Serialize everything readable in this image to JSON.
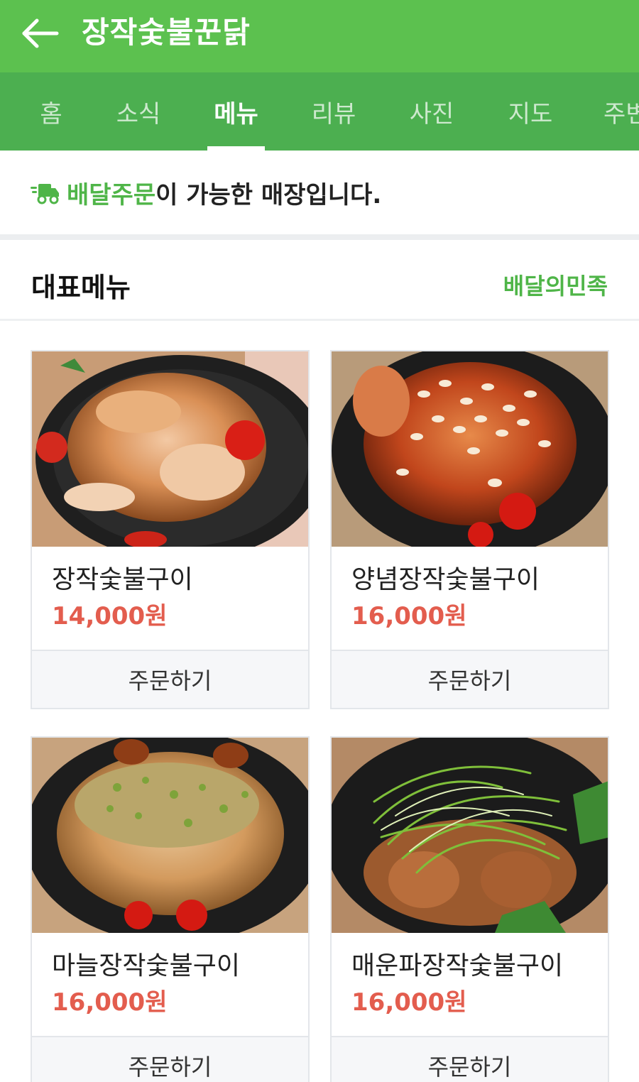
{
  "header": {
    "title": "장작숯불꾼닭",
    "back_icon": "back-arrow-icon"
  },
  "tabs": [
    {
      "label": "홈",
      "active": false
    },
    {
      "label": "소식",
      "active": false
    },
    {
      "label": "메뉴",
      "active": true
    },
    {
      "label": "리뷰",
      "active": false
    },
    {
      "label": "사진",
      "active": false
    },
    {
      "label": "지도",
      "active": false
    },
    {
      "label": "주변",
      "active": false
    }
  ],
  "notice": {
    "icon": "delivery-truck-icon",
    "accent_text": "배달주문",
    "rest_text": "이 가능한 매장입니다."
  },
  "section": {
    "title": "대표메뉴",
    "link": "배달의민족"
  },
  "menu": [
    {
      "name": "장작숯불구이",
      "price": "14,000원",
      "order_label": "주문하기"
    },
    {
      "name": "양념장작숯불구이",
      "price": "16,000원",
      "order_label": "주문하기"
    },
    {
      "name": "마늘장작숯불구이",
      "price": "16,000원",
      "order_label": "주문하기"
    },
    {
      "name": "매운파장작숯불구이",
      "price": "16,000원",
      "order_label": "주문하기"
    }
  ],
  "colors": {
    "header": "#5cc14f",
    "tabbar": "#4caf50",
    "accent": "#4fb548",
    "price": "#e35d4e"
  }
}
